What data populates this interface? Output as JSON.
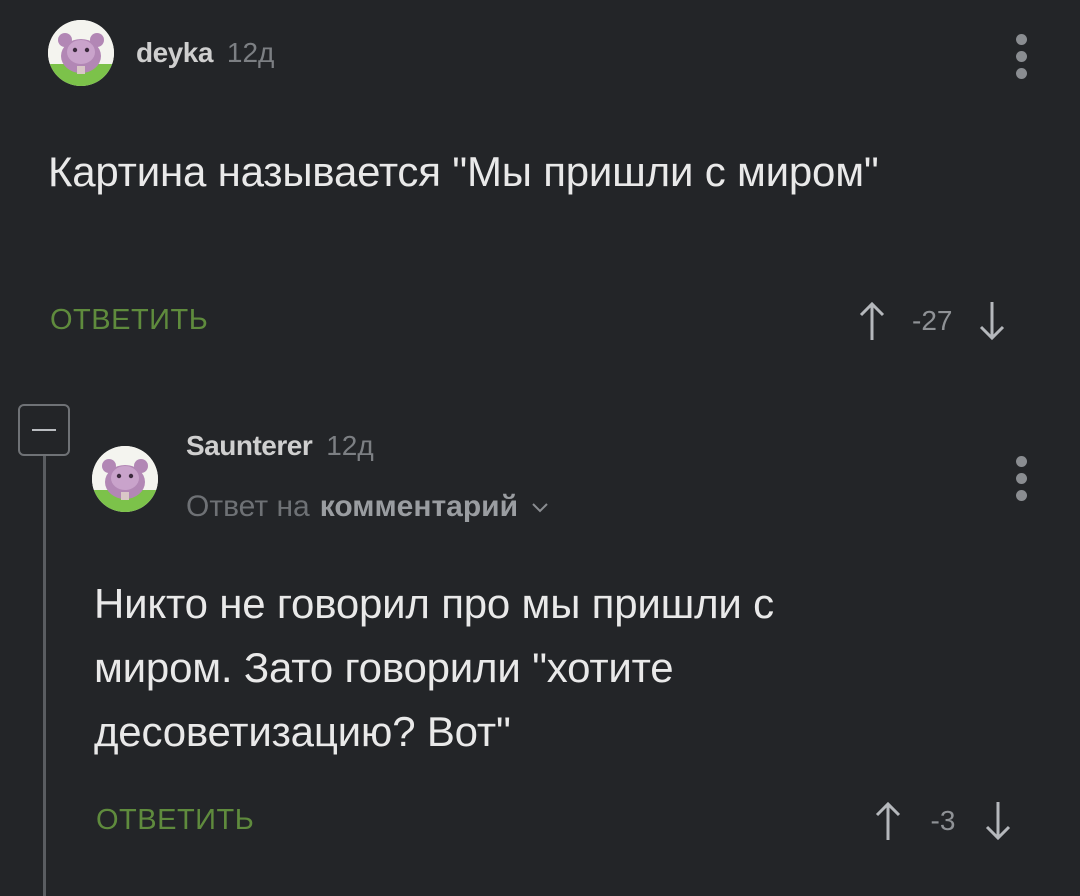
{
  "comments": [
    {
      "username": "deyka",
      "time": "12д",
      "text": "Картина называется \"Мы пришли с миром\"",
      "reply_label": "ОТВЕТИТЬ",
      "score": "-27"
    },
    {
      "username": "Saunterer",
      "time": "12д",
      "reply_to_prefix": "Ответ на",
      "reply_to_link": "комментарий",
      "text": "Никто не говорил про мы пришли с миром. Зато говорили \"хотите десоветизацию? Вот\"",
      "reply_label": "ОТВЕТИТЬ",
      "score": "-3"
    }
  ],
  "colors": {
    "background": "#232528",
    "reply_green": "#5f8b3d",
    "muted": "#8f9296"
  },
  "icons": {
    "upvote": "arrow-up-icon",
    "downvote": "arrow-down-icon",
    "menu": "kebab-menu-icon",
    "collapse": "minus-icon"
  }
}
